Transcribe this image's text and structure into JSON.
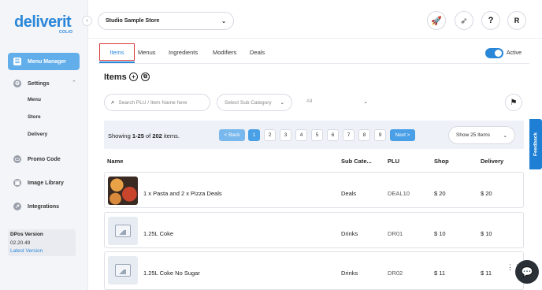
{
  "brand": {
    "name": "deliverit",
    "sub": "COLIO"
  },
  "sidebar": {
    "collapse_glyph": "‹",
    "items": [
      {
        "label": "Menu Manager",
        "icon": "menu-icon",
        "active": true
      },
      {
        "label": "Settings",
        "icon": "gear-icon"
      },
      {
        "label": "Promo Code",
        "icon": "promo-icon"
      },
      {
        "label": "Image Library",
        "icon": "image-icon"
      },
      {
        "label": "Integrations",
        "icon": "integrations-icon"
      }
    ],
    "settings_sub": [
      "Menu",
      "Store",
      "Delivery"
    ],
    "version": {
      "title": "DPos Version",
      "number": "02.20.49",
      "link": "Latest Version"
    }
  },
  "topbar": {
    "store": "Studio Sample Store",
    "help": "?",
    "avatar": "R"
  },
  "tabs": [
    "Items",
    "Menus",
    "Ingredients",
    "Modifiers",
    "Deals"
  ],
  "active_toggle": {
    "label": "Active",
    "on": true
  },
  "items_header": {
    "title": "Items"
  },
  "filters": {
    "search_placeholder": "Search PLU / Item Name here",
    "subcategory_placeholder": "Select Sub Category",
    "all": "All"
  },
  "pagination": {
    "showing_prefix": "Showing ",
    "range": "1-25",
    "of": " of ",
    "total": "202",
    "suffix": " items.",
    "back": "< Back",
    "pages": [
      "1",
      "2",
      "3",
      "4",
      "5",
      "6",
      "7",
      "8",
      "9"
    ],
    "current_page": "1",
    "next": "Next >",
    "per_page": "Show 25 Items"
  },
  "table": {
    "headers": [
      "Name",
      "Sub Cate...",
      "PLU",
      "Shop",
      "Delivery"
    ],
    "rows": [
      {
        "name": "1 x Pasta and 2 x Pizza Deals",
        "sub": "Deals",
        "plu": "DEAL10",
        "shop": "$ 20",
        "delivery": "$ 20",
        "thumb": "food"
      },
      {
        "name": "1.25L Coke",
        "sub": "Drinks",
        "plu": "DR01",
        "shop": "$ 10",
        "delivery": "$ 10",
        "thumb": "placeholder"
      },
      {
        "name": "1.25L Coke No Sugar",
        "sub": "Drinks",
        "plu": "DR02",
        "shop": "$ 11",
        "delivery": "$ 11",
        "thumb": "placeholder"
      }
    ]
  },
  "feedback": {
    "label": "Feedback"
  },
  "colors": {
    "accent": "#2a87d8",
    "active_nav": "#62aeea",
    "highlight": "#d83a3a"
  }
}
